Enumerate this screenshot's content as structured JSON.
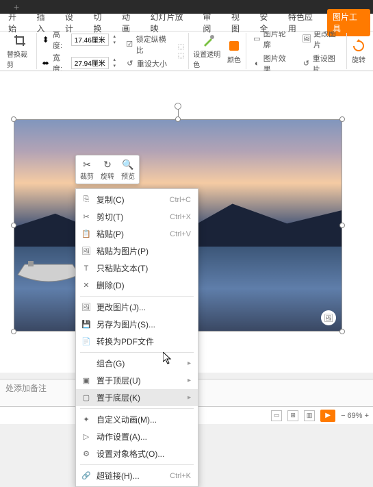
{
  "titlebar": {
    "plus": "+"
  },
  "tabs": [
    "开始",
    "插入",
    "设计",
    "切换",
    "动画",
    "幻灯片放映",
    "审阅",
    "视图",
    "安全",
    "特色应用",
    "图片工具"
  ],
  "tabs_active_index": 10,
  "ribbon": {
    "replace_crop": "替换裁剪",
    "height_label": "高度:",
    "height_value": "17.46厘米",
    "width_label": "宽度:",
    "width_value": "27.94厘米",
    "lock_ratio": "锁定纵横比",
    "reset_size": "重设大小",
    "transparency": "设置透明色",
    "color": "颜色",
    "outline": "图片轮廓",
    "effect": "图片效果",
    "change": "更改图片",
    "reset": "重设图片",
    "rotate": "旋转"
  },
  "floatbar": {
    "crop": "裁剪",
    "rotate": "旋转",
    "preview": "预览"
  },
  "menu": {
    "copy": "复制(C)",
    "copy_key": "Ctrl+C",
    "cut": "剪切(T)",
    "cut_key": "Ctrl+X",
    "paste": "粘贴(P)",
    "paste_key": "Ctrl+V",
    "paste_as_pic": "粘贴为图片(P)",
    "paste_text": "只粘贴文本(T)",
    "delete": "删除(D)",
    "change_pic": "更改图片(J)...",
    "save_as_pic": "另存为图片(S)...",
    "to_pdf": "转换为PDF文件",
    "group": "组合(G)",
    "bring_front": "置于顶层(U)",
    "send_back": "置于底层(K)",
    "custom_anim": "自定义动画(M)...",
    "action_set": "动作设置(A)...",
    "format_obj": "设置对象格式(O)...",
    "hyperlink": "超链接(H)...",
    "hyperlink_key": "Ctrl+K"
  },
  "notes": "处添加备注",
  "status": {
    "zoom": "69%"
  }
}
